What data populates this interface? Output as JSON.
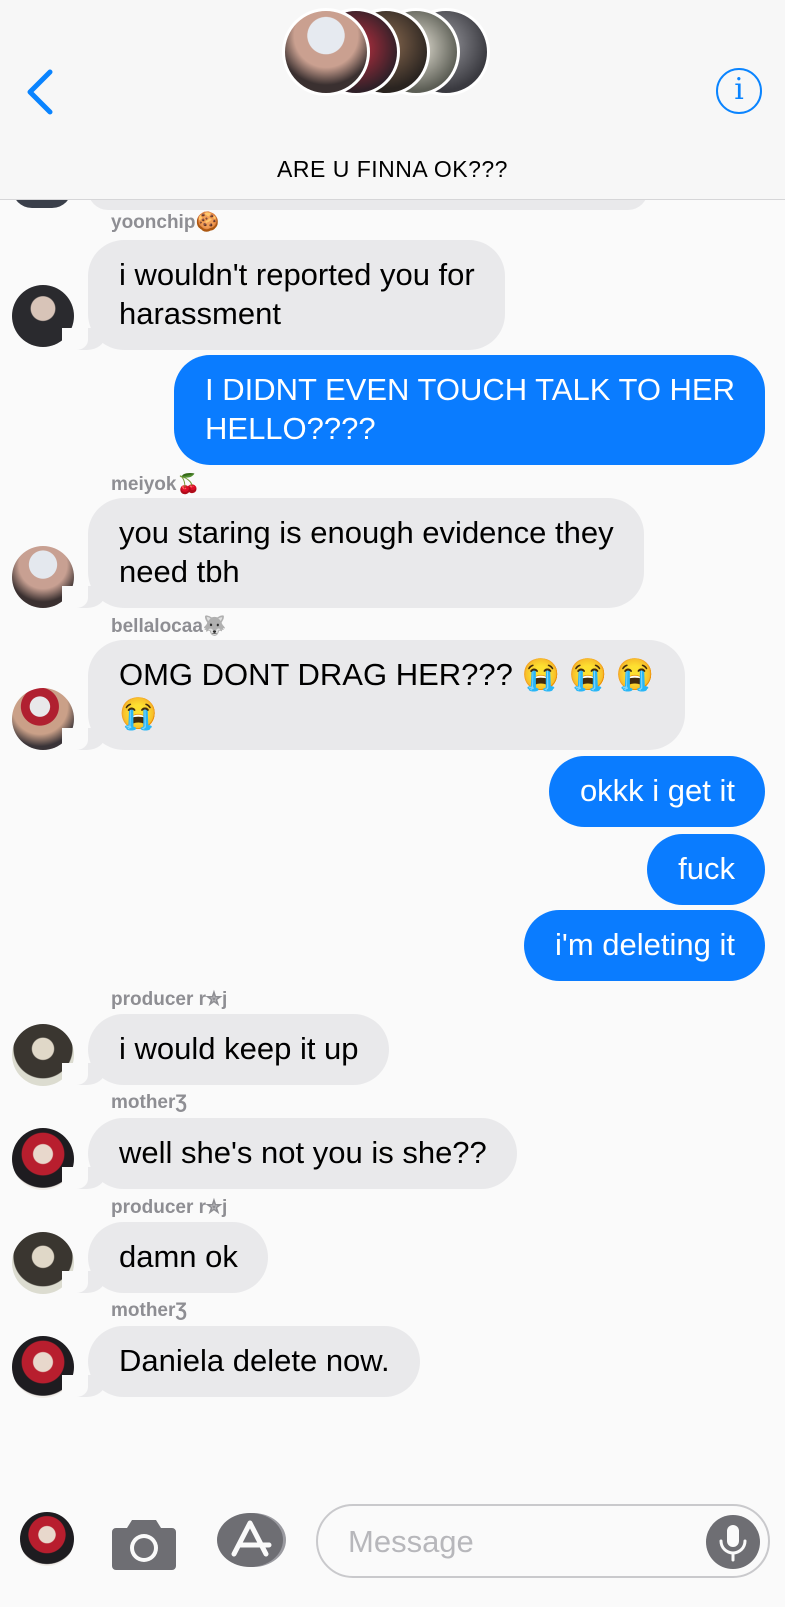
{
  "header": {
    "title": "ARE U FINNA OK???",
    "back_icon": "chevron-left-icon",
    "info_icon": "info-icon",
    "info_glyph": "i",
    "accent_color": "#0a84ff"
  },
  "messages": [
    {
      "direction": "in",
      "sender": "yoonchip🍪",
      "text_lines": [
        "i wouldn't reported you for",
        "harassment"
      ]
    },
    {
      "direction": "out",
      "text_lines": [
        "I DIDNT EVEN TOUCH TALK TO HER",
        "HELLO????"
      ]
    },
    {
      "direction": "in",
      "sender": "meiyok🍒",
      "text_lines": [
        "you staring is enough evidence they",
        "need tbh"
      ]
    },
    {
      "direction": "in",
      "sender": "bellalocaa🐺",
      "text_lines": [
        "OMG DONT DRAG HER??? 😭 😭 😭",
        "😭"
      ]
    },
    {
      "direction": "out",
      "text_lines": [
        "okkk i get it"
      ]
    },
    {
      "direction": "out",
      "text_lines": [
        "fuck"
      ]
    },
    {
      "direction": "out",
      "text_lines": [
        "i'm deleting it"
      ]
    },
    {
      "direction": "in",
      "sender": "producer r✮j",
      "text_lines": [
        "i would keep it up"
      ]
    },
    {
      "direction": "in",
      "sender": "motherƷ",
      "text_lines": [
        "well she's not you is she??"
      ]
    },
    {
      "direction": "in",
      "sender": "producer r✮j",
      "text_lines": [
        "damn ok"
      ]
    },
    {
      "direction": "in",
      "sender": "motherƷ",
      "text_lines": [
        "Daniela delete now."
      ]
    }
  ],
  "input_bar": {
    "placeholder": "Message",
    "camera_icon": "camera-icon",
    "apps_icon": "app-store-icon",
    "mic_icon": "microphone-icon"
  },
  "colors": {
    "outgoing_bubble": "#0a7cff",
    "incoming_bubble": "#e9e9eb",
    "sender_name": "#8e8e93"
  }
}
